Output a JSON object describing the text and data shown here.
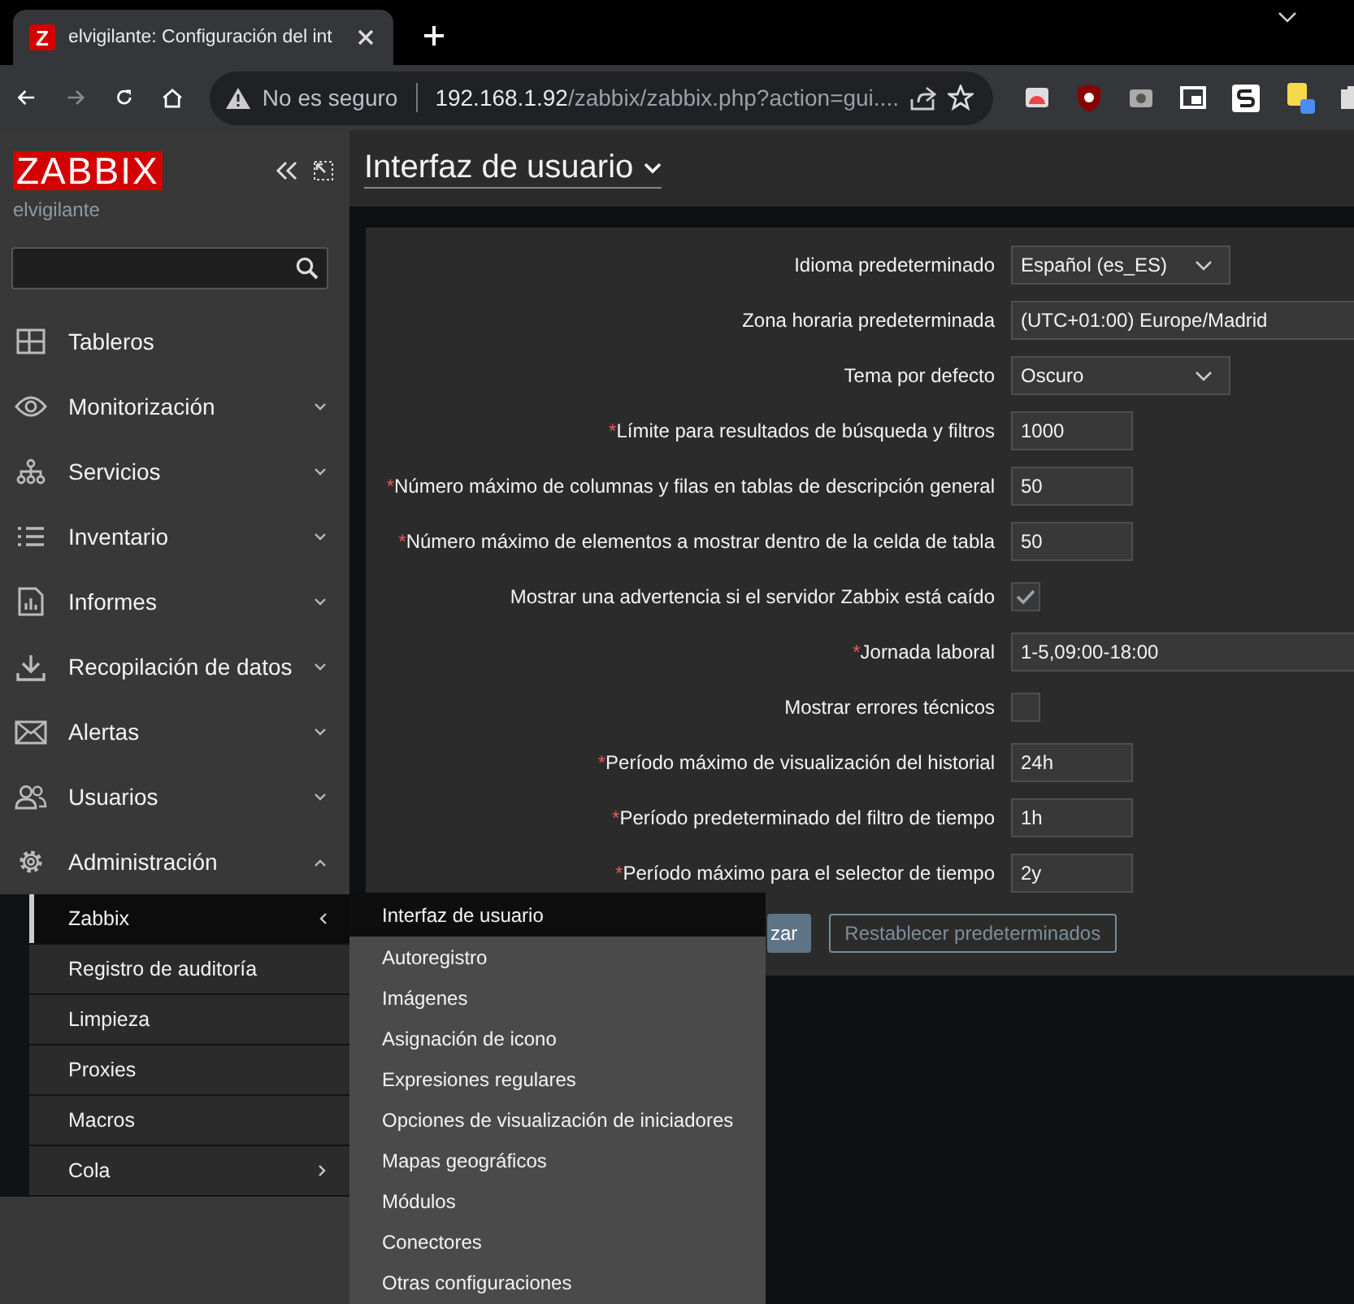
{
  "browser": {
    "favicon_letter": "Z",
    "tab_title": "elvigilante: Configuración del int",
    "security": "No es seguro",
    "url_host": "192.168.1.92",
    "url_path": "/zabbix/zabbix.php?action=gui...."
  },
  "sidebar": {
    "logo": "ZABBIX",
    "user": "elvigilante",
    "menu": [
      {
        "label": "Tableros"
      },
      {
        "label": "Monitorización",
        "expanded": false
      },
      {
        "label": "Servicios",
        "expanded": false
      },
      {
        "label": "Inventario",
        "expanded": false
      },
      {
        "label": "Informes",
        "expanded": false
      },
      {
        "label": "Recopilación de datos",
        "expanded": false
      },
      {
        "label": "Alertas",
        "expanded": false
      },
      {
        "label": "Usuarios",
        "expanded": false
      },
      {
        "label": "Administración",
        "expanded": true,
        "children": [
          {
            "label": "Zabbix",
            "selected": true,
            "expanded": true
          },
          {
            "label": "Registro de auditoría",
            "selected": false
          },
          {
            "label": "Limpieza",
            "selected": false
          },
          {
            "label": "Proxies",
            "selected": false
          },
          {
            "label": "Macros",
            "selected": false
          },
          {
            "label": "Cola",
            "selected": false,
            "expanded": false
          }
        ]
      }
    ]
  },
  "page": {
    "title": "Interfaz de usuario"
  },
  "form": {
    "fields": [
      {
        "kind": "select",
        "label": "Idioma predeterminado",
        "value": "Español (es_ES)"
      },
      {
        "kind": "select-wide",
        "label": "Zona horaria predeterminada",
        "value": "(UTC+01:00) Europe/Madrid"
      },
      {
        "kind": "select",
        "label": "Tema por defecto",
        "value": "Oscuro"
      },
      {
        "kind": "input",
        "required_mark": "*",
        "label": "Límite para resultados de búsqueda y filtros",
        "value": "1000"
      },
      {
        "kind": "input",
        "required_mark": "*",
        "label": "Número máximo de columnas y filas en tablas de descripción general",
        "value": "50"
      },
      {
        "kind": "input",
        "required_mark": "*",
        "label": "Número máximo de elementos a mostrar dentro de la celda de tabla",
        "value": "50"
      },
      {
        "kind": "checkbox",
        "label": "Mostrar una advertencia si el servidor Zabbix está caído",
        "checked": true
      },
      {
        "kind": "input-wide",
        "required_mark": "*",
        "label": "Jornada laboral",
        "value": "1-5,09:00-18:00"
      },
      {
        "kind": "checkbox",
        "label": "Mostrar errores técnicos",
        "checked": false
      },
      {
        "kind": "input",
        "required_mark": "*",
        "label": "Período máximo de visualización del historial",
        "value": "24h"
      },
      {
        "kind": "input",
        "required_mark": "*",
        "label": "Período predeterminado del filtro de tiempo",
        "value": "1h"
      },
      {
        "kind": "input",
        "required_mark": "*",
        "label": "Período máximo para el selector de tiempo",
        "value": "2y"
      }
    ],
    "buttons": [
      {
        "label": "zar",
        "kind": "primary"
      },
      {
        "label": "Restablecer predeterminados",
        "kind": "secondary"
      }
    ]
  },
  "flyout": [
    {
      "label": "Interfaz de usuario",
      "selected": true
    },
    {
      "label": "Autoregistro",
      "selected": false
    },
    {
      "label": "Imágenes",
      "selected": false
    },
    {
      "label": "Asignación de icono",
      "selected": false
    },
    {
      "label": "Expresiones regulares",
      "selected": false
    },
    {
      "label": "Opciones de visualización de iniciadores",
      "selected": false
    },
    {
      "label": "Mapas geográficos",
      "selected": false
    },
    {
      "label": "Módulos",
      "selected": false
    },
    {
      "label": "Conectores",
      "selected": false
    },
    {
      "label": "Otras configuraciones",
      "selected": false
    }
  ]
}
